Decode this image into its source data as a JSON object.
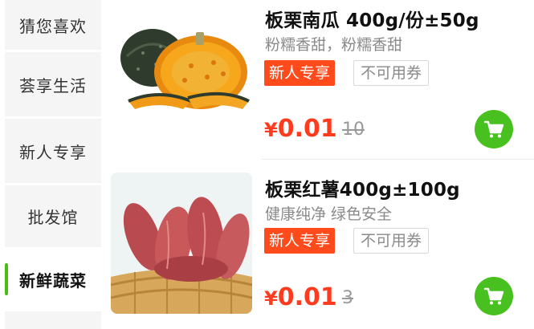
{
  "sidebar": {
    "categories": [
      {
        "label": "猜您喜欢"
      },
      {
        "label": "荟享生活"
      },
      {
        "label": "新人专享"
      },
      {
        "label": "批发馆"
      },
      {
        "label": "新鲜蔬菜",
        "active": true
      }
    ],
    "accent_color": "#4cbb17"
  },
  "products": [
    {
      "name": "板栗南瓜 400g/份±50g",
      "description": "粉糯香甜，粉糯香甜",
      "tags": [
        "新人专享",
        "不可用券"
      ],
      "currency": "¥",
      "price": "0.01",
      "original_price": "10",
      "image_icon": "pumpkin-image"
    },
    {
      "name": "板栗红薯400g±100g",
      "description": "健康纯净 绿色安全",
      "tags": [
        "新人专享",
        "不可用券"
      ],
      "currency": "¥",
      "price": "0.01",
      "original_price": "3",
      "image_icon": "sweet-potato-image"
    }
  ],
  "colors": {
    "price": "#ff3b1f",
    "tag_new": "#ff4a1c",
    "cart_button": "#48c020"
  }
}
